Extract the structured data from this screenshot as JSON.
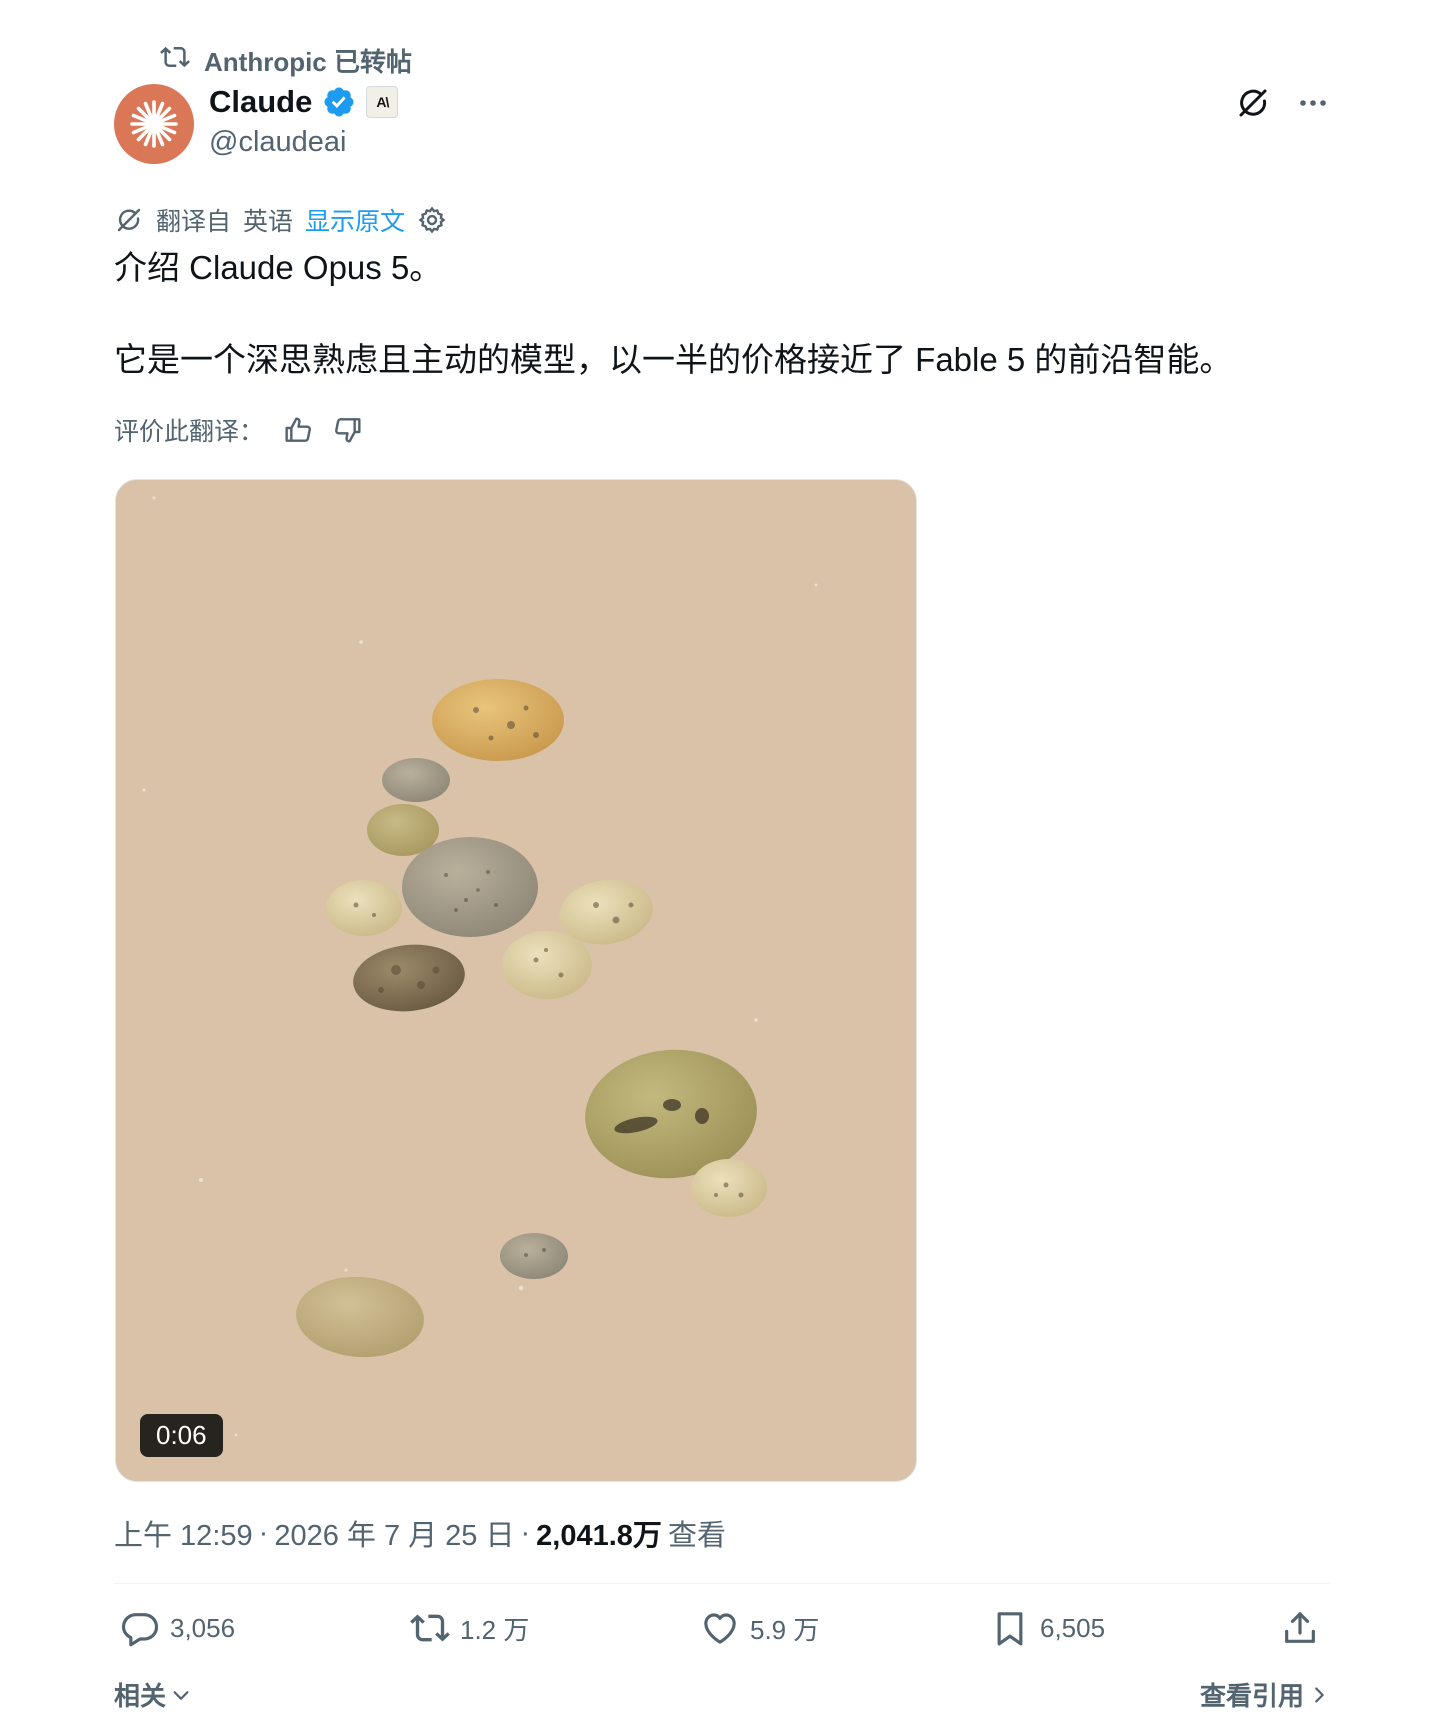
{
  "repost_banner": {
    "text": "Anthropic 已转帖"
  },
  "author": {
    "display_name": "Claude",
    "handle": "@claudeai",
    "affiliate_badge": "A\\",
    "avatar_color": "#d97757",
    "verified": true
  },
  "translation": {
    "label": "翻译自",
    "language": "英语",
    "show_original": "显示原文"
  },
  "tweet": {
    "line1": "介绍 Claude Opus 5。",
    "line2": "它是一个深思熟虑且主动的模型，以一半的价格接近了 Fable 5 的前沿智能。"
  },
  "rating": {
    "label": "评价此翻译："
  },
  "media": {
    "duration": "0:06",
    "background": "#d9c2a7"
  },
  "meta": {
    "time": "上午 12:59",
    "sep1": "·",
    "date": "2026 年 7 月 25 日",
    "sep2": "·",
    "views": "2,041.8万",
    "views_label": "查看"
  },
  "actions": {
    "replies": "3,056",
    "reposts": "1.2 万",
    "likes": "5.9 万",
    "bookmarks": "6,505"
  },
  "footer": {
    "related": "相关",
    "view_quotes": "查看引用"
  },
  "icons": [
    "retweet-icon",
    "verified-icon",
    "grok-icon",
    "more-icon",
    "translate-icon",
    "gear-icon",
    "thumbs-up-icon",
    "thumbs-down-icon",
    "reply-icon",
    "like-icon",
    "bookmark-icon",
    "share-icon",
    "chevron-down-icon",
    "chevron-right-icon"
  ],
  "colors": {
    "link": "#1d9bf0",
    "muted": "#536471",
    "text": "#0f1419"
  }
}
